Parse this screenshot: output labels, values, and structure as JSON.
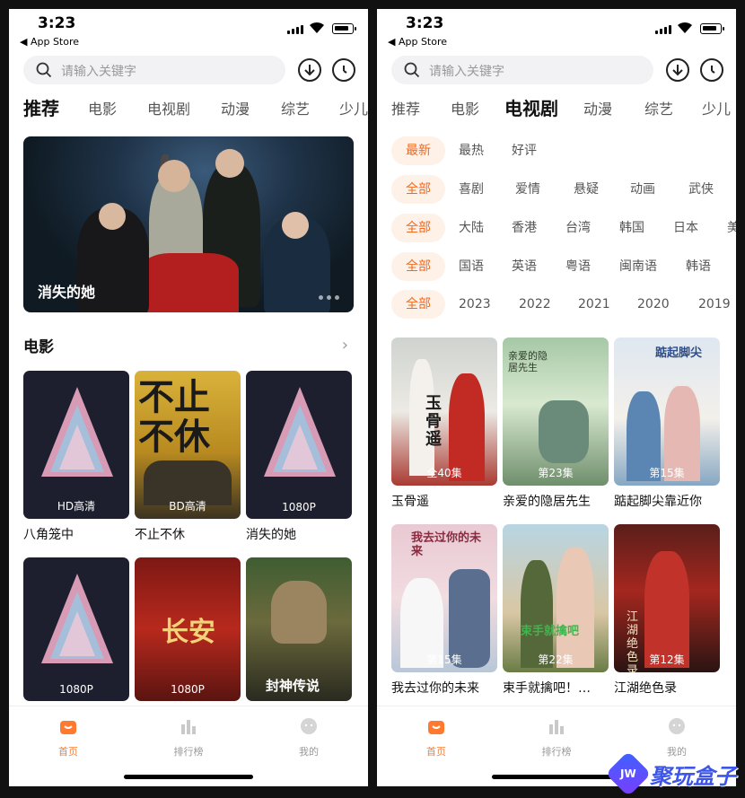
{
  "status": {
    "time": "3:23",
    "back_label": "◀ App Store"
  },
  "search": {
    "placeholder": "请输入关键字"
  },
  "tabs": [
    "推荐",
    "电影",
    "电视剧",
    "动漫",
    "综艺",
    "少儿"
  ],
  "screen1": {
    "active_tab": "推荐",
    "banner": {
      "caption": "消失的她"
    },
    "section": {
      "title": "电影"
    },
    "movies": [
      {
        "title": "八角笼中",
        "badge": "HD高清"
      },
      {
        "title": "不止不休",
        "badge": "BD高清"
      },
      {
        "title": "消失的她",
        "badge": "1080P"
      },
      {
        "title": "",
        "badge": "1080P"
      },
      {
        "title": "",
        "badge": "1080P"
      },
      {
        "title": "",
        "badge": ""
      }
    ],
    "poster_texts": {
      "p2": "不止不休",
      "p5": "长安",
      "p6": "封神传说"
    }
  },
  "screen2": {
    "active_tab": "电视剧",
    "filters": {
      "sort": [
        "最新",
        "最热",
        "好评"
      ],
      "genre": [
        "全部",
        "喜剧",
        "爱情",
        "悬疑",
        "动画",
        "武侠"
      ],
      "region": [
        "全部",
        "大陆",
        "香港",
        "台湾",
        "韩国",
        "日本",
        "美"
      ],
      "language": [
        "全部",
        "国语",
        "英语",
        "粤语",
        "闽南语",
        "韩语"
      ],
      "year": [
        "全部",
        "2023",
        "2022",
        "2021",
        "2020",
        "2019"
      ]
    },
    "shows": [
      {
        "title": "玉骨遥",
        "badge": "全40集"
      },
      {
        "title": "亲爱的隐居先生",
        "badge": "第23集"
      },
      {
        "title": "踮起脚尖靠近你",
        "badge": "第15集"
      },
      {
        "title": "我去过你的未来",
        "badge": "第15集"
      },
      {
        "title": "束手就擒吧！…",
        "badge": "第22集"
      },
      {
        "title": "江湖绝色录",
        "badge": "第12集"
      }
    ],
    "poster_texts": {
      "s1": "玉骨遥",
      "s2": "亲爱的隐居先生",
      "s3": "踮起脚尖",
      "s4": "我去过你的未来",
      "s5": "束手就擒吧",
      "s6": "江湖绝色录"
    }
  },
  "nav": {
    "home": "首页",
    "rank": "排行榜",
    "mine": "我的"
  },
  "watermark": {
    "logo": "JW",
    "text": "聚玩盒子"
  },
  "colors": {
    "accent": "#f06a1f",
    "chip_bg": "#fdf1e8"
  }
}
